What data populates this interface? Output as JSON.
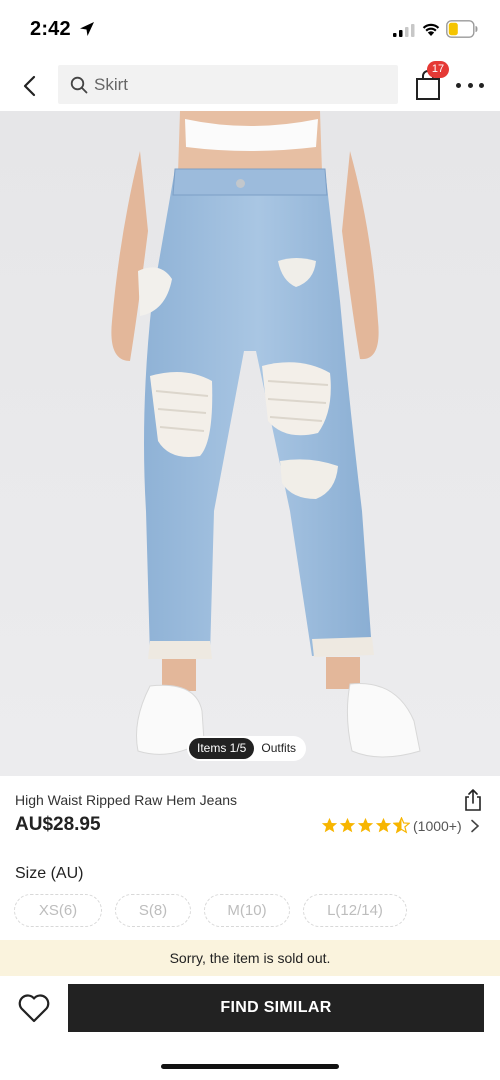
{
  "status_bar": {
    "time": "2:42",
    "icons": [
      "location-arrow-icon",
      "signal-icon",
      "wifi-icon",
      "battery-icon"
    ],
    "battery_color": "#f5c400"
  },
  "nav": {
    "search_text": "Skirt",
    "cart_count": "17",
    "icons": [
      "back-icon",
      "search-icon",
      "shopping-bag-icon",
      "more-icon"
    ],
    "badge_color": "#e53935"
  },
  "image": {
    "toggle_items": "Items 1/5",
    "toggle_outfits": "Outfits"
  },
  "product": {
    "name": "High Waist Ripped Raw Hem Jeans",
    "price": "AU$28.95",
    "rating_value": 4.5,
    "rating_count": "(1000+)",
    "star_color": "#f7b500"
  },
  "size": {
    "label": "Size (AU)",
    "options": [
      "XS(6)",
      "S(8)",
      "M(10)",
      "L(12/14)"
    ]
  },
  "banner": {
    "message": "Sorry, the item is sold out.",
    "background": "#faf3dd"
  },
  "actions": {
    "find_similar": "FIND SIMILAR",
    "button_color": "#222222"
  }
}
